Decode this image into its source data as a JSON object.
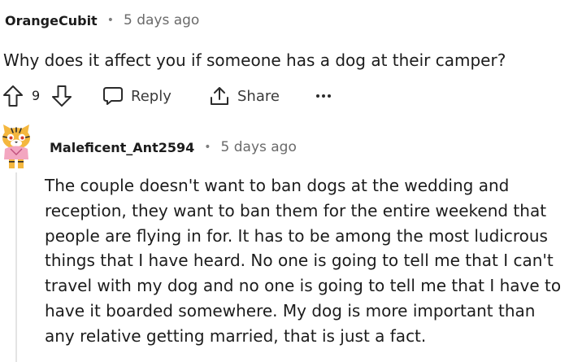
{
  "comment": {
    "author": "OrangeCubit",
    "separator": "•",
    "time": "5 days ago",
    "body": "Why does it affect you if someone has a dog at their camper?",
    "actions": {
      "upvote_icon": "arrow-up-outline-icon",
      "score": "9",
      "downvote_icon": "arrow-down-outline-icon",
      "reply_icon": "speech-bubble-icon",
      "reply_label": "Reply",
      "share_icon": "share-upload-icon",
      "share_label": "Share",
      "more_label": "•••"
    }
  },
  "reply": {
    "avatar_icon": "cartoon-tiger-avatar",
    "author": "Maleficent_Ant2594",
    "separator": "•",
    "time": "5 days ago",
    "body_lines": [
      "The couple doesn't want to ban dogs at the wedding and",
      "reception, they want to ban them for the entire weekend that",
      "people are flying in for. It has to be among the most ludicrous",
      "things that I have heard. No one is going to tell me that I can't",
      "travel with my dog and no one is going to tell me that I have to",
      "have it boarded somewhere. My dog is more important than",
      "any relative getting married, that is just a fact."
    ]
  },
  "colors": {
    "text": "#1c1c1c",
    "meta": "#6a6a6a",
    "thread_line": "#e4e4e4",
    "avatar_fur": "#f4b73e"
  }
}
